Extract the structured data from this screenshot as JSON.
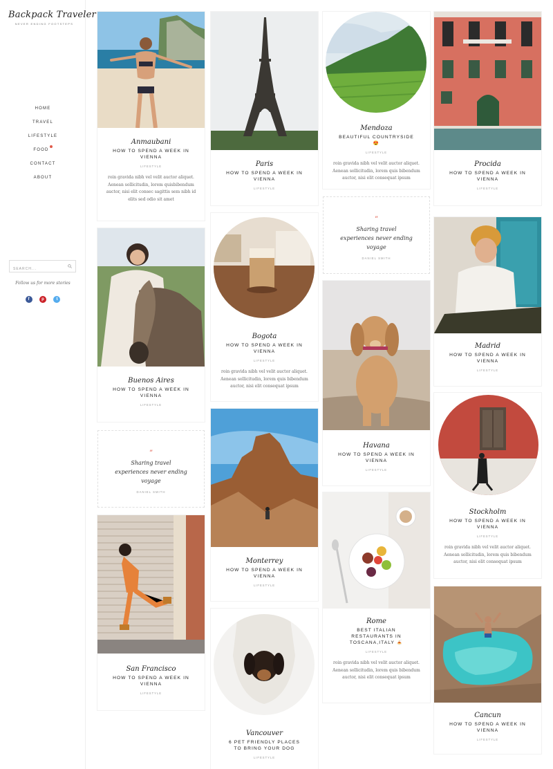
{
  "site": {
    "name": "Backpack Traveler",
    "tagline": "NEVER ENDING FOOTSTEPS"
  },
  "nav": {
    "items": [
      "HOME",
      "TRAVEL",
      "LIFESTYLE",
      "FOOD",
      "CONTACT",
      "ABOUT"
    ],
    "food_badge_color": "#e05a4a"
  },
  "search": {
    "placeholder": "SEARCH..."
  },
  "follow": {
    "text": "Follow us for more stories"
  },
  "social": [
    "facebook-icon",
    "pinterest-icon",
    "twitter-icon"
  ],
  "colors": {
    "accent": "#e05a4a",
    "facebook": "#3b5998",
    "pinterest": "#cb2027",
    "twitter": "#55acee"
  },
  "posts": [
    {
      "city": "Anmaubani",
      "title": "HOW TO SPEND A WEEK IN VIENNA",
      "category": "LIFESTYLE",
      "excerpt": "roin gravida nibh vel velit auctor aliquet. Aenean sollicitudin, lorem quisbibendum auctor, nisi elit consec sagittis sem nibh id elits sed odio sit amet"
    },
    {
      "city": "Paris",
      "title": "HOW TO SPEND A WEEK IN VIENNA",
      "category": "LIFESTYLE"
    },
    {
      "city": "Mendoza",
      "title": "BEAUTIFUL COUNTRYSIDE 😍",
      "category": "LIFESTYLE",
      "excerpt": "roin gravida nibh vel velit auctor aliquet. Aenean sollicitudin, lorem quis bibendum auctor, nisi elit consequat ipsum"
    },
    {
      "city": "Procida",
      "title": "HOW TO SPEND A WEEK IN VIENNA",
      "category": "LIFESTYLE"
    },
    {
      "city": "Bogota",
      "title": "HOW TO SPEND A WEEK IN VIENNA",
      "category": "LIFESTYLE",
      "excerpt": "roin gravida nibh vel velit auctor aliquet. Aenean sollicitudin, lorem quis bibendum auctor, nisi elit consequat ipsum"
    },
    {
      "city": "Madrid",
      "title": "HOW TO SPEND A WEEK IN VIENNA",
      "category": "LIFESTYLE"
    },
    {
      "city": "Buenos Aires",
      "title": "HOW TO SPEND A WEEK IN VIENNA",
      "category": "LIFESTYLE"
    },
    {
      "city": "Havana",
      "title": "HOW TO SPEND A WEEK IN VIENNA",
      "category": "LIFESTYLE"
    },
    {
      "city": "Stockholm",
      "title": "HOW TO SPEND A WEEK IN VIENNA",
      "category": "LIFESTYLE",
      "excerpt": "roin gravida nibh vel velit auctor aliquet. Aenean sollicitudin, lorem quis bibendum auctor, nisi elit consequat ipsum"
    },
    {
      "city": "Monterrey",
      "title": "HOW TO SPEND A WEEK IN VIENNA",
      "category": "LIFESTYLE"
    },
    {
      "city": "San Francisco",
      "title": "HOW TO SPEND A WEEK IN VIENNA",
      "category": "LIFESTYLE"
    },
    {
      "city": "Rome",
      "title": "BEST ITALIAN RESTAURANTS IN TOSCANA,ITALY 🍝",
      "category": "LIFESTYLE",
      "excerpt": "roin gravida nibh vel velit auctor aliquet. Aenean sollicitudin, lorem quis bibendum auctor, nisi elit consequat ipsum"
    },
    {
      "city": "Cancun",
      "title": "HOW TO SPEND A WEEK IN VIENNA",
      "category": "LIFESTYLE"
    },
    {
      "city": "Vancouver",
      "title": "6 PET FRIENDLY PLACES TO BRING YOUR DOG",
      "category": "LIFESTYLE"
    }
  ],
  "quotes": [
    {
      "mark": "”",
      "text": "Sharing travel experiences never ending voyage",
      "author": "DANIEL SMITH"
    },
    {
      "mark": "”",
      "text": "Sharing travel experiences never ending voyage",
      "author": "DANIEL SMITH"
    }
  ]
}
